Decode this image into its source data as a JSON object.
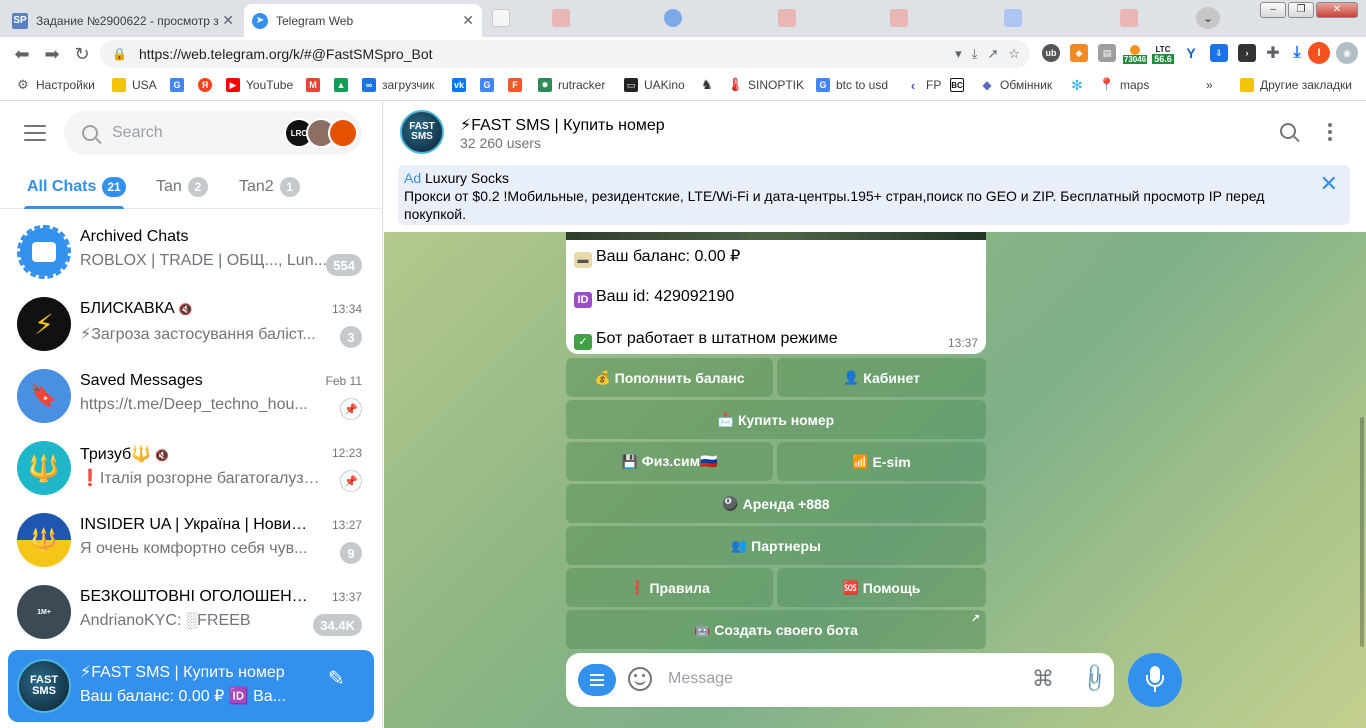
{
  "browser": {
    "tabs": [
      {
        "title": "Задание №2900622 - просмотр з",
        "favicon_text": "SP",
        "favicon_color": "#5b7fc4"
      },
      {
        "title": "Telegram Web",
        "favicon_text": "➤",
        "favicon_color": "#3390ec"
      }
    ],
    "url": "https://web.telegram.org/k/#@FastSMSpro_Bot",
    "ext_ltc_label": "LTC",
    "ext_ltc_value": "56.6",
    "ext_btc_value": "73046",
    "profile_initial": "I"
  },
  "bookmarks": [
    {
      "label": "Настройки",
      "icon": "gear-icon",
      "color": "#5f6368"
    },
    {
      "label": "USA",
      "icon": "folder-icon",
      "color": "#f4c20d"
    },
    {
      "label": "",
      "icon": "google-icon",
      "color": "#4285f4"
    },
    {
      "label": "",
      "icon": "yandex-icon",
      "color": "#fc3f1d"
    },
    {
      "label": "YouTube",
      "icon": "youtube-icon",
      "color": "#ff0000"
    },
    {
      "label": "",
      "icon": "gmail-icon",
      "color": "#ea4335"
    },
    {
      "label": "",
      "icon": "drive-icon",
      "color": "#0f9d58"
    },
    {
      "label": "загрузчик",
      "icon": "loop-icon",
      "color": "#1a73e8"
    },
    {
      "label": "",
      "icon": "vk-icon",
      "color": "#0077ff"
    },
    {
      "label": "",
      "icon": "translate-icon",
      "color": "#4285f4"
    },
    {
      "label": "",
      "icon": "f-icon",
      "color": "#f05a28"
    },
    {
      "label": "rutracker",
      "icon": "star-icon",
      "color": "#2e8b57"
    },
    {
      "label": "UAKino",
      "icon": "film-icon",
      "color": "#222"
    },
    {
      "label": "",
      "icon": "chess-icon",
      "color": "#333"
    },
    {
      "label": "SINOPTIK",
      "icon": "thermometer-icon",
      "color": "#d32f2f"
    },
    {
      "label": "btc to usd",
      "icon": "google-icon",
      "color": "#4285f4"
    },
    {
      "label": "FP",
      "icon": "chevron-left-icon",
      "color": "#3f51b5"
    },
    {
      "label": "",
      "icon": "bc-icon",
      "color": "#111"
    },
    {
      "label": "Обмінник",
      "icon": "diamond-icon",
      "color": "#5c6bc0"
    },
    {
      "label": "",
      "icon": "snowflake-icon",
      "color": "#29b6f6"
    },
    {
      "label": "maps",
      "icon": "map-pin-icon",
      "color": "#34a853"
    }
  ],
  "bookmarks_more": "»",
  "bookmarks_other": "Другие закладки",
  "sidebar": {
    "search_placeholder": "Search",
    "search_avatars": [
      "LRC",
      "",
      ""
    ],
    "folders": [
      {
        "label": "All Chats",
        "count": "21"
      },
      {
        "label": "Tan",
        "count": "2"
      },
      {
        "label": "Tan2",
        "count": "1"
      }
    ],
    "chats": [
      {
        "name": "Archived Chats",
        "preview": "ROBLOX | TRADE | ОБЩ..., Lun...",
        "time": "",
        "badge": "554",
        "pinned": false,
        "muted": false,
        "avatar_color": "#3390ec"
      },
      {
        "name": "БЛИСКАВКА",
        "preview": "⚡Загроза застосування баліст...",
        "time": "13:34",
        "badge": "3",
        "pinned": false,
        "muted": true,
        "avatar_color": "#111111"
      },
      {
        "name": "Saved Messages",
        "preview": "https://t.me/Deep_techno_hou...",
        "time": "Feb 11",
        "badge": "",
        "pinned": true,
        "muted": false,
        "avatar_color": "#4a90e2"
      },
      {
        "name": "Тризуб🔱",
        "preview": "❗Італія розгорне багатогалузев...",
        "time": "12:23",
        "badge": "",
        "pinned": true,
        "muted": true,
        "avatar_color": "#1fb6c9"
      },
      {
        "name": "INSIDER UA | Україна | Новини",
        "preview": "Я очень комфортно себя чув...",
        "time": "13:27",
        "badge": "9",
        "pinned": false,
        "muted": true,
        "avatar_color": "#1f57b0"
      },
      {
        "name": "БЕЗКОШТОВНІ ОГОЛОШЕН...",
        "preview": "AndrianoKYC: ░FREEB",
        "time": "13:37",
        "badge": "34.4K",
        "pinned": false,
        "muted": true,
        "avatar_color": "#3b4a55"
      },
      {
        "name": "⚡FAST SMS | Купить номер",
        "preview": "Ваш баланс: 0.00 ₽ 🆔 Ва...",
        "time": "",
        "badge": "",
        "pinned": false,
        "muted": false,
        "avatar_color": "#0c1f2e"
      }
    ]
  },
  "chat": {
    "title": "⚡FAST SMS | Купить номер",
    "subtitle": "32 260 users",
    "avatar_text_top": "FAST",
    "avatar_text_bottom": "SMS",
    "ad": {
      "label": "Ad",
      "sponsor": "Luxury Socks",
      "text": "Прокси от $0.2 !Мобильные, резидентские, LTE/Wi-Fi и дата-центры.195+ стран,поиск по GEO и ZIP. Бесплатный просмотр IP перед покупкой."
    },
    "message": {
      "balance": "Ваш баланс: 0.00 ₽",
      "id": "Ваш id: 429092190",
      "status": "Бот работает в штатном режиме",
      "time": "13:37"
    },
    "keyboard": [
      {
        "label": "Пополнить баланс",
        "icon": "money-bag-icon",
        "glyph": "💰"
      },
      {
        "label": "Кабинет",
        "icon": "user-icon",
        "glyph": "👤"
      },
      {
        "label": "Купить номер",
        "icon": "inbox-icon",
        "glyph": "📩"
      },
      {
        "label": "Физ.сим🇷🇺",
        "icon": "floppy-icon",
        "glyph": "💾"
      },
      {
        "label": "E-sim",
        "icon": "signal-icon",
        "glyph": "📶"
      },
      {
        "label": "Аренда +888",
        "icon": "8ball-icon",
        "glyph": "🎱"
      },
      {
        "label": "Партнеры",
        "icon": "users-icon",
        "glyph": "👥"
      },
      {
        "label": "Правила",
        "icon": "exclamation-icon",
        "glyph": "❗"
      },
      {
        "label": "Помощь",
        "icon": "sos-icon",
        "glyph": "🆘"
      },
      {
        "label": "Создать своего бота",
        "icon": "robot-icon",
        "glyph": "🤖"
      }
    ],
    "composer_placeholder": "Message"
  }
}
